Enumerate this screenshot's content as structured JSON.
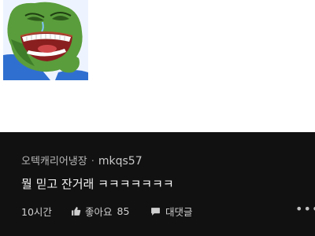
{
  "meme": {
    "icon": "pepe-frog-laughing-image"
  },
  "comment": {
    "author_channel": "오텍캐리어냉장",
    "separator": "·",
    "handle": "mkqs57",
    "text": "뭘 믿고 잔거래 ㅋㅋㅋㅋㅋㅋㅋ",
    "time_ago": "10시간",
    "like_label": "좋아요",
    "like_count": "85",
    "reply_label": "대댓글",
    "more_icon": "more-dots-icon"
  },
  "colors": {
    "card_background": "#111111",
    "meme_background": "#e8f1ff"
  }
}
